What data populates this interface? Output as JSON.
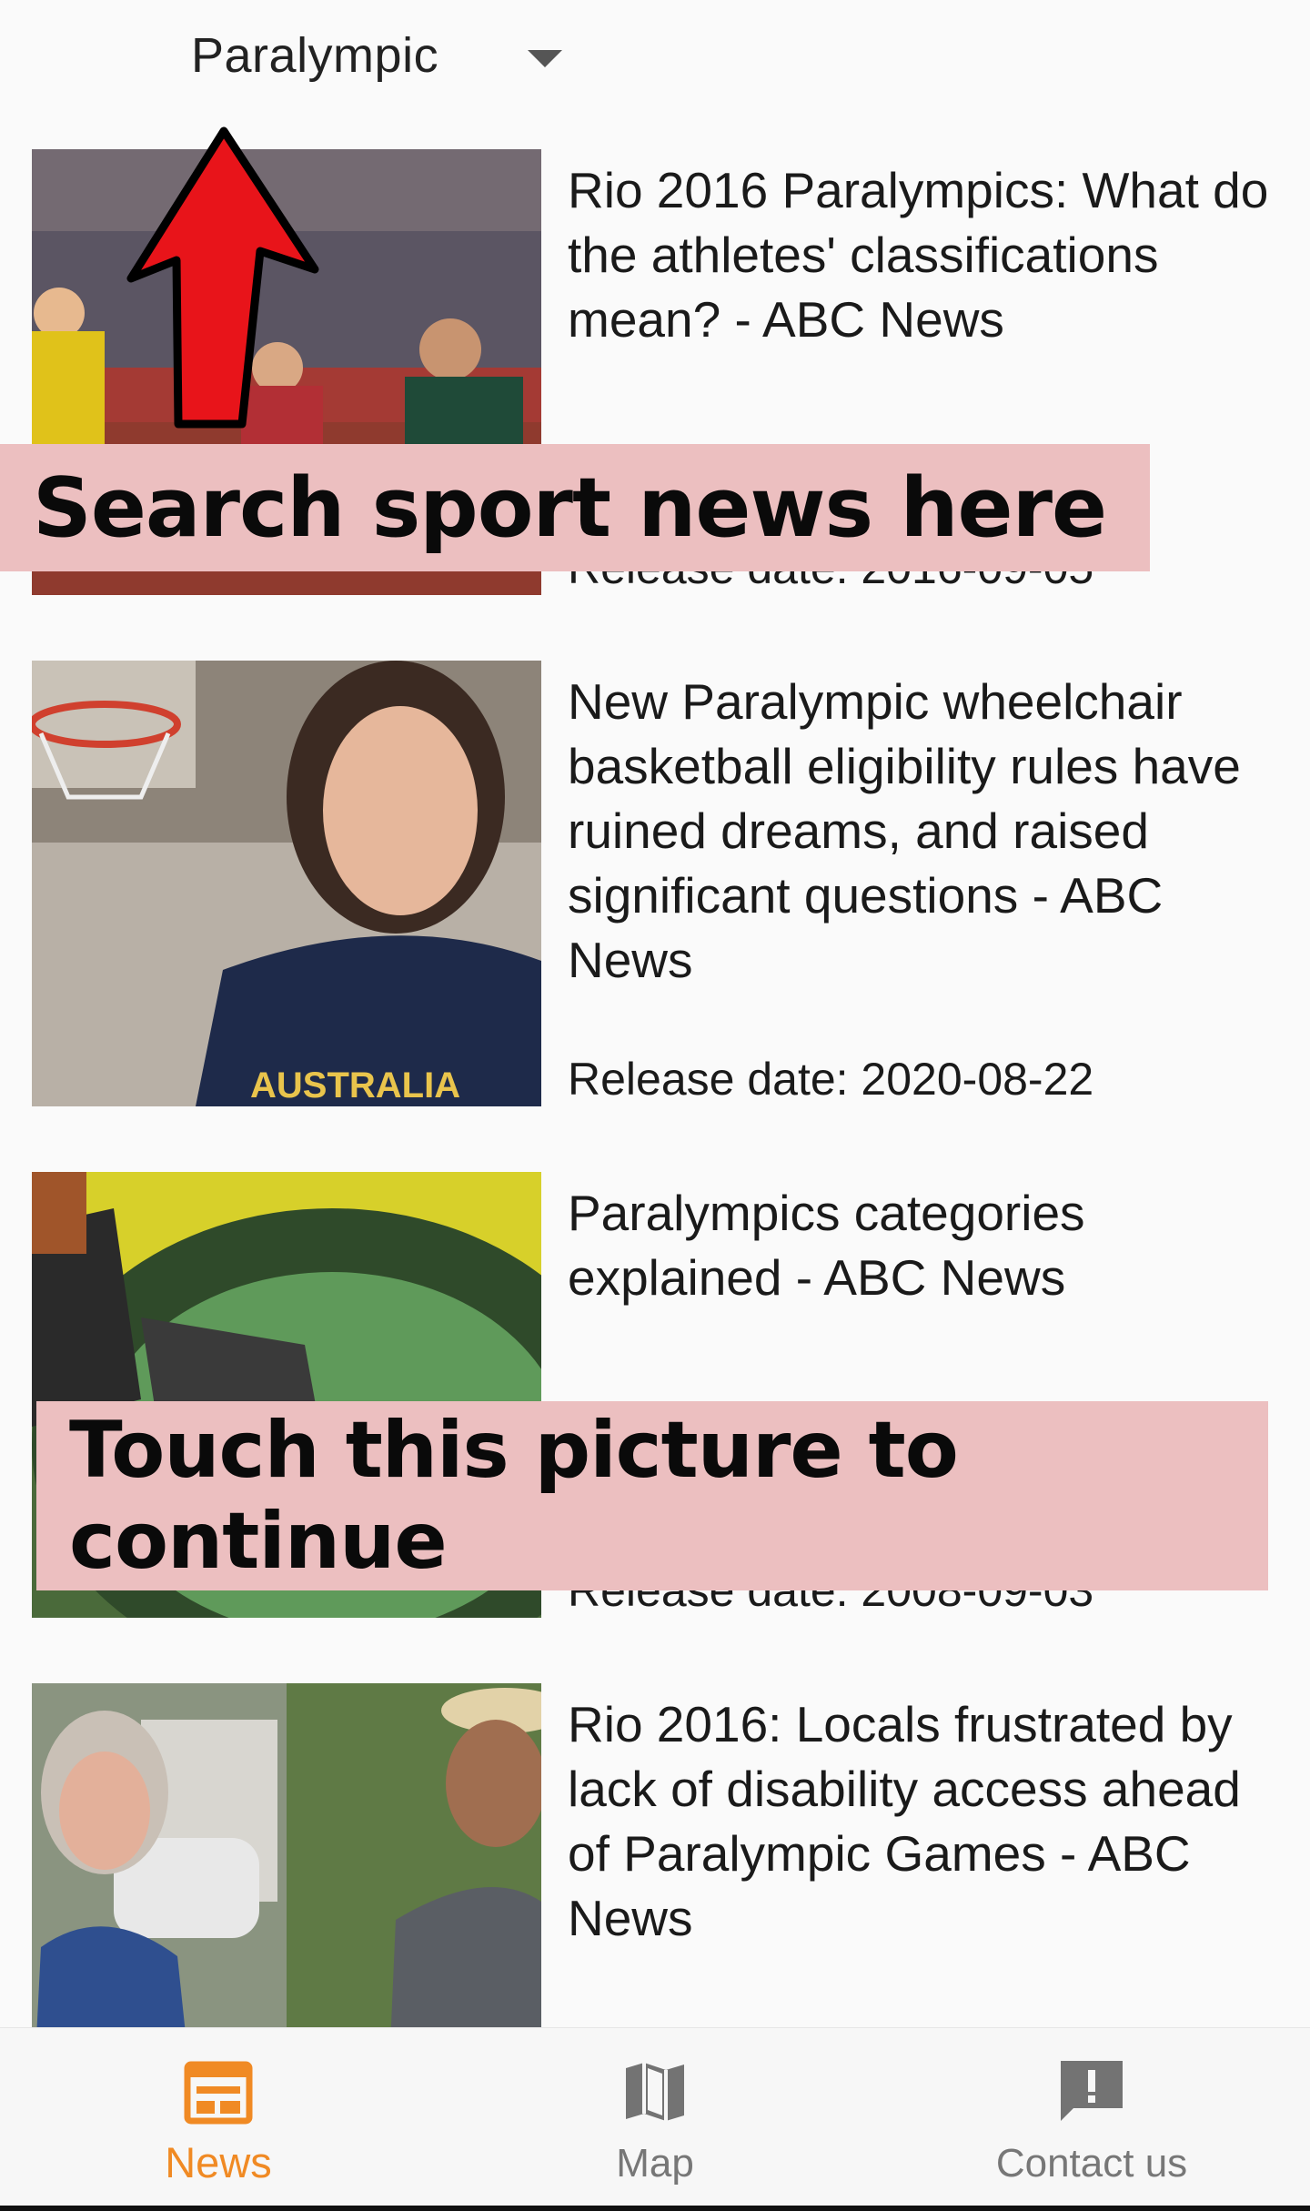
{
  "header": {
    "category_dropdown": {
      "selected": "Paralympic"
    }
  },
  "news": [
    {
      "title": "Rio 2016 Paralympics: What do the athletes' classifications mean? - ABC News",
      "date": "Release date: 2016-09-05"
    },
    {
      "title": "New Paralympic wheelchair basketball eligibility rules have ruined dreams, and raised significant questions - ABC News",
      "date": "Release date: 2020-08-22"
    },
    {
      "title": "Paralympics categories explained - ABC News",
      "date": "Release date: 2008-09-03"
    },
    {
      "title": "Rio 2016: Locals frustrated by lack of disability access ahead of Paralympic Games - ABC News",
      "date": ""
    }
  ],
  "overlays": {
    "top_hint": "Search sport news here",
    "middle_hint": "Touch this picture to continue"
  },
  "bottom_nav": {
    "items": [
      {
        "label": "News",
        "icon": "news-icon",
        "active": true
      },
      {
        "label": "Map",
        "icon": "map-icon",
        "active": false
      },
      {
        "label": "Contact us",
        "icon": "feedback-icon",
        "active": false
      }
    ]
  },
  "colors": {
    "accent": "#f08a24",
    "overlay_background": "#ecbfc0",
    "arrow": "#e8141a"
  }
}
